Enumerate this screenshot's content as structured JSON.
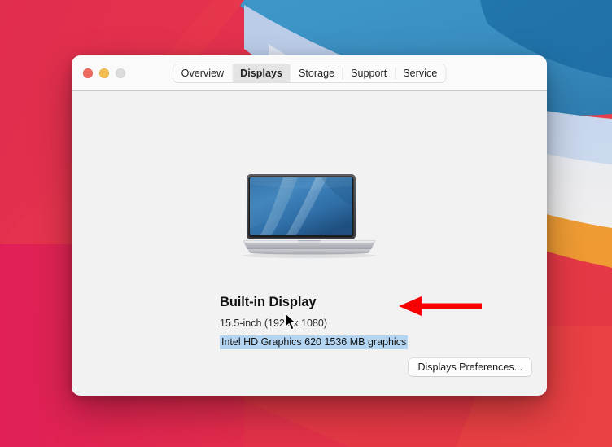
{
  "window": {
    "traffic_lights": [
      {
        "name": "close",
        "color": "#ec6a5f",
        "label": "Close"
      },
      {
        "name": "minimize",
        "color": "#f4bd4f",
        "label": "Minimize"
      },
      {
        "name": "zoom",
        "color": "#dcdcdc",
        "label": "Zoom"
      }
    ],
    "tabs": [
      {
        "label": "Overview",
        "selected": false,
        "separator": false
      },
      {
        "label": "Displays",
        "selected": true,
        "separator": false
      },
      {
        "label": "Storage",
        "selected": false,
        "separator": false
      },
      {
        "label": "Support",
        "selected": false,
        "separator": true
      },
      {
        "label": "Service",
        "selected": false,
        "separator": true
      }
    ]
  },
  "main": {
    "device_image": "macbook-pro-laptop",
    "display_title": "Built-in Display",
    "display_size": "15.5-inch (1920 x 1080)",
    "display_graphics": "Intel HD Graphics 620 1536 MB graphics",
    "graphics_selected": true,
    "preferences_button": "Displays Preferences..."
  },
  "annotation": {
    "arrow_icon": "left-arrow-annotation",
    "arrow_color": "#f80000",
    "points_at": "display_graphics"
  },
  "cursor": {
    "icon": "arrow-pointer-cursor"
  },
  "colors": {
    "window_background": "#f2f2f2",
    "titlebar_background": "#fafafa",
    "tab_selected_background": "#e4e4e4",
    "selection_highlight": "#b4d5f2",
    "annotation_red": "#f80000",
    "wallpaper_red": "#e8384f",
    "wallpaper_blue": "#2f82b8"
  }
}
